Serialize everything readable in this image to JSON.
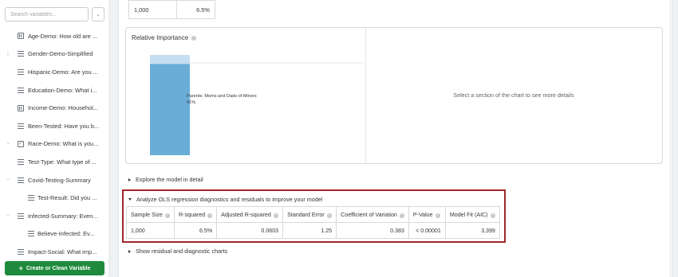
{
  "sidebar": {
    "search_placeholder": "Search variables...",
    "search_button_icon": "chevron-down",
    "items": [
      {
        "label": "Age-Demo: How old are ...",
        "icon": "bar-chart",
        "expander": ""
      },
      {
        "label": "Gender-Demo-Simplified",
        "icon": "list",
        "expander": "⋮"
      },
      {
        "label": "Hispanic-Demo: Are you ...",
        "icon": "list",
        "expander": ""
      },
      {
        "label": "Education-Demo: What i...",
        "icon": "list",
        "expander": ""
      },
      {
        "label": "Income-Demo: Househol...",
        "icon": "bar-chart",
        "expander": ""
      },
      {
        "label": "Been-Tested: Have you b...",
        "icon": "list",
        "expander": ""
      },
      {
        "label": "Race-Demo: What is you...",
        "icon": "checkbox",
        "expander": "›"
      },
      {
        "label": "Test-Type: What type of ...",
        "icon": "list",
        "expander": ""
      },
      {
        "label": "Covid-Testing-Summary",
        "icon": "list",
        "expander": "−"
      },
      {
        "label": "Test-Result: Did you ...",
        "icon": "list",
        "expander": "",
        "indent": true
      },
      {
        "label": "Infected-Summary: Even...",
        "icon": "list",
        "expander": "−"
      },
      {
        "label": "Believe-Infected: Ev...",
        "icon": "list",
        "expander": "",
        "indent": true
      },
      {
        "label": "Impact-Social: What imp...",
        "icon": "list",
        "expander": ""
      }
    ],
    "create_button": "Create or Clean Variable",
    "accent": "#1f8a3d"
  },
  "top_table": {
    "sample_size": "1,000",
    "r_squared": "6.5%"
  },
  "relative_importance": {
    "title": "Relative Importance",
    "bar_label": "Parents: Moms and Dads of Minors",
    "bar_value_text": "91%",
    "hint": "Select a section of the chart to see more details",
    "bar_color": "#6aaed8",
    "bar_rest_color": "#c5dff0"
  },
  "chart_data": {
    "type": "bar",
    "categories": [
      "Parents: Moms and Dads of Minors"
    ],
    "values": [
      91
    ],
    "ylim": [
      0,
      100
    ],
    "title": "Relative Importance"
  },
  "explore_link": "Explore the model in detail",
  "ols": {
    "header": "Analyze OLS regression diagnostics and residuals to improve your model",
    "columns": [
      "Sample Size",
      "R-squared",
      "Adjusted R-squared",
      "Standard Error",
      "Coefficient of Variation",
      "P-Value",
      "Model Fit (AIC)"
    ],
    "values": [
      "1,000",
      "6.5%",
      "0.0603",
      "1.25",
      "0.383",
      "< 0.00001",
      "3,399"
    ],
    "highlight_color": "#a0262a"
  },
  "residual_link": "Show residual and diagnostic charts"
}
